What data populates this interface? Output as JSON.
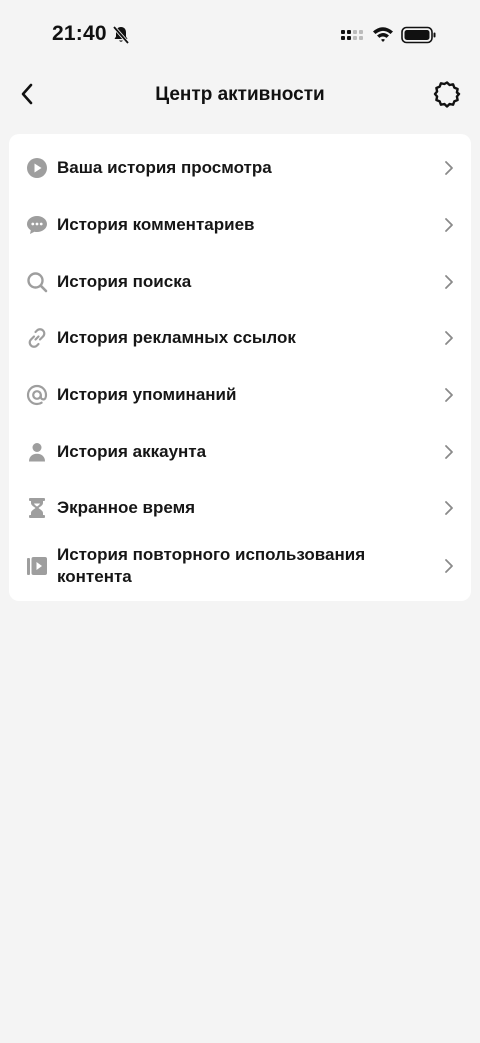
{
  "status_bar": {
    "time": "21:40",
    "icons": [
      "bell-muted-icon",
      "signal-icon",
      "wifi-icon",
      "battery-icon"
    ]
  },
  "header": {
    "title": "Центр активности",
    "back_icon": "chevron-left-icon",
    "settings_icon": "gear-icon"
  },
  "menu": {
    "items": [
      {
        "label": "Ваша история просмотра",
        "icon": "play-circle-icon"
      },
      {
        "label": "История комментариев",
        "icon": "comment-bubble-icon"
      },
      {
        "label": "История поиска",
        "icon": "search-icon"
      },
      {
        "label": "История рекламных ссылок",
        "icon": "link-icon"
      },
      {
        "label": "История упоминаний",
        "icon": "at-sign-icon"
      },
      {
        "label": "История аккаунта",
        "icon": "person-icon"
      },
      {
        "label": "Экранное время",
        "icon": "hourglass-icon"
      },
      {
        "label": "История повторного использования контента",
        "icon": "video-reuse-icon"
      }
    ]
  },
  "colors": {
    "background": "#f4f4f4",
    "card": "#ffffff",
    "icon_gray": "#9e9e9e",
    "text": "#161616"
  }
}
